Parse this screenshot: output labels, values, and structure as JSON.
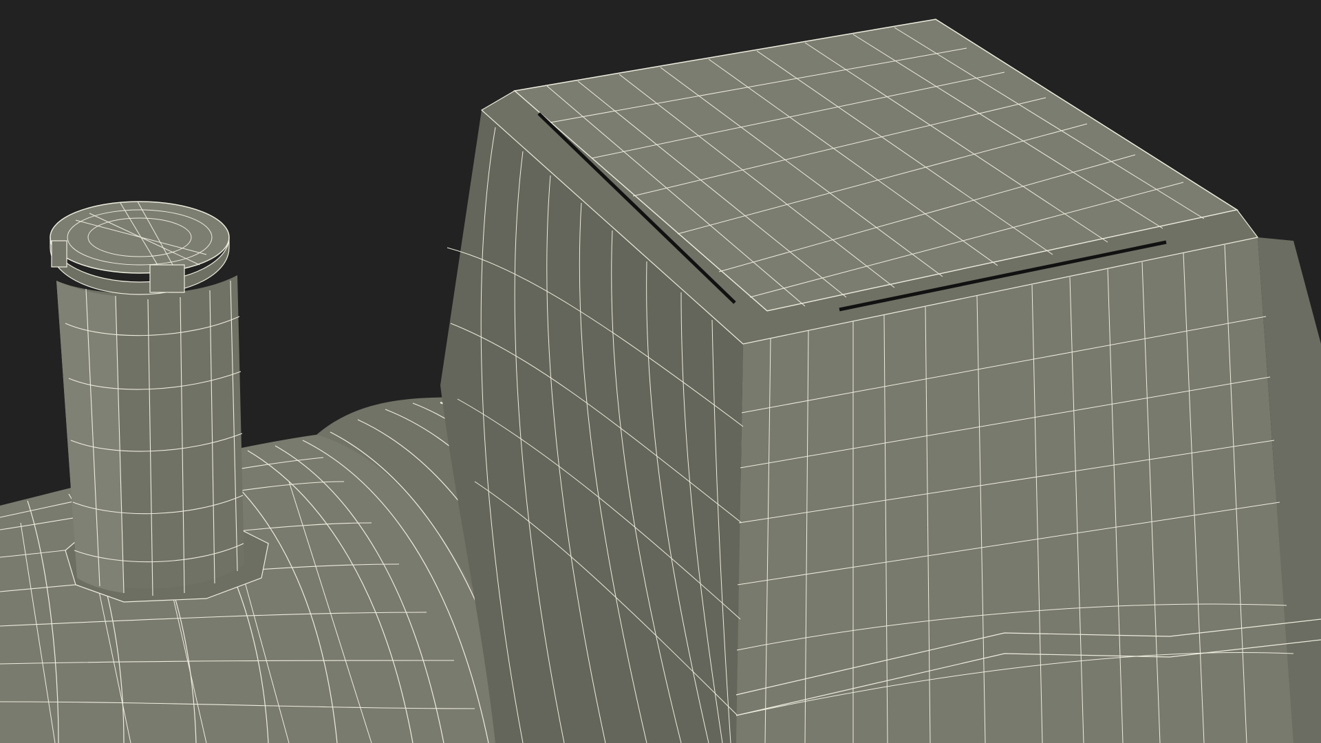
{
  "scene": {
    "subject": "wireframe-tank-render",
    "parts": [
      "tank-body",
      "vent-pipe",
      "access-hatch"
    ]
  },
  "colors": {
    "background": "#222222",
    "surface": "#797a6e",
    "surface_dark": "#66675c",
    "surface_light": "#8a8b7f",
    "wire": "#eeeedf",
    "seam": "#111111"
  }
}
